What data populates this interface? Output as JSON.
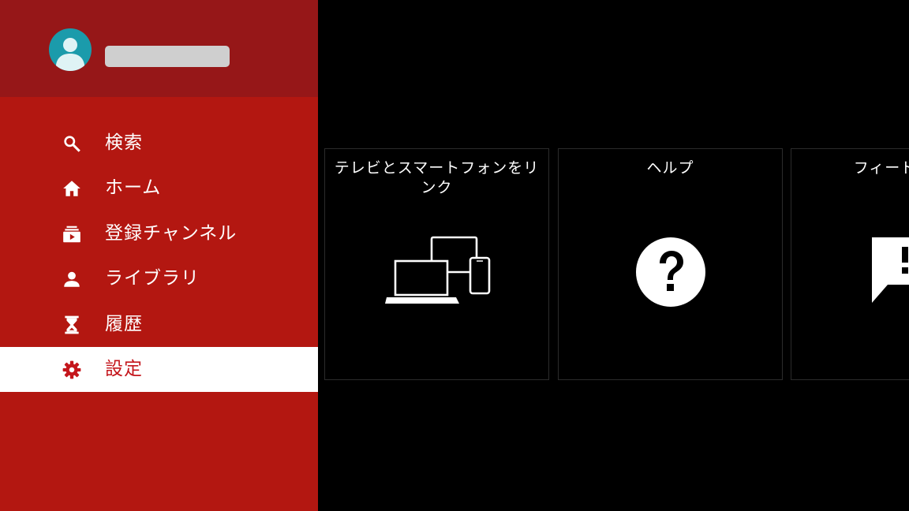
{
  "account": {
    "avatar_icon": "account-avatar-icon",
    "name_redacted": ""
  },
  "colors": {
    "sidebar": "#b31711",
    "account_header": "#961718",
    "avatar": "#1b9bab",
    "selected_item_bg": "#ffffff",
    "selected_item_fg": "#c4161c",
    "background": "#000000"
  },
  "sidebar": {
    "items": [
      {
        "label": "検索",
        "icon": "search-icon",
        "selected": false
      },
      {
        "label": "ホーム",
        "icon": "home-icon",
        "selected": false
      },
      {
        "label": "登録チャンネル",
        "icon": "subscriptions-icon",
        "selected": false
      },
      {
        "label": "ライブラリ",
        "icon": "person-icon",
        "selected": false
      },
      {
        "label": "履歴",
        "icon": "hourglass-icon",
        "selected": false
      },
      {
        "label": "設定",
        "icon": "gear-icon",
        "selected": true
      }
    ]
  },
  "tiles": [
    {
      "label": "テレビとスマートフォンをリンク",
      "icon": "devices-icon"
    },
    {
      "label": "ヘルプ",
      "icon": "help-icon"
    },
    {
      "label": "フィードバック",
      "icon": "feedback-icon"
    }
  ]
}
